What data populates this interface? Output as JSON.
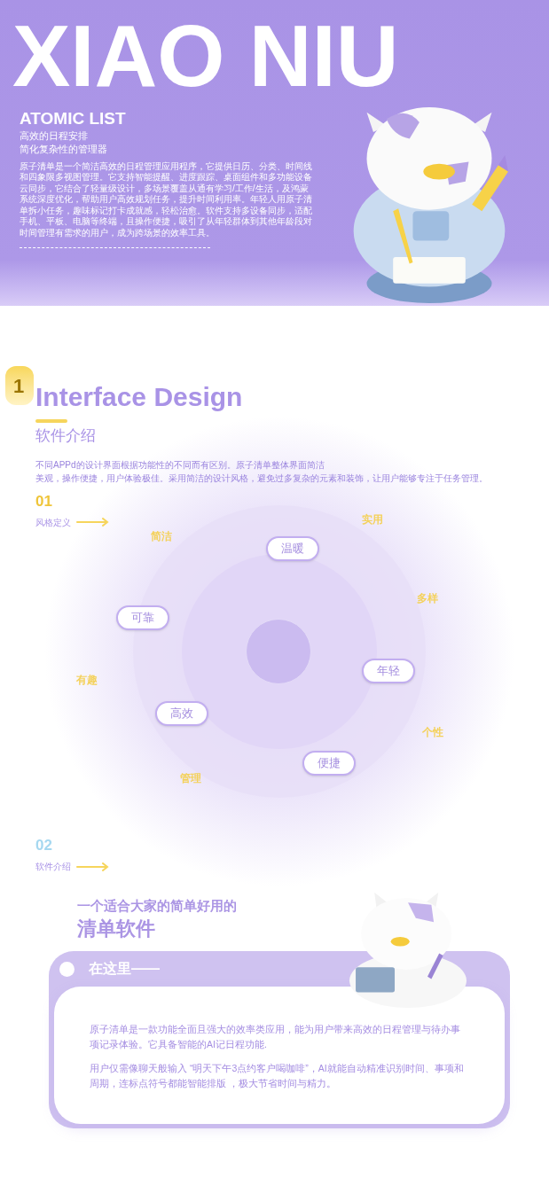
{
  "hero": {
    "title": "XIAO NIU",
    "brand": "ATOMIC LIST",
    "taglines": [
      "高效的日程安排",
      "简化复杂性的管理器"
    ],
    "description": "原子清单是一个简洁高效的日程管理应用程序，它提供日历、分类、时间线和四象限多视图管理。它支持智能提醒、进度跟踪、桌面组件和多功能设备云同步，它结合了轻量级设计，多场景覆盖从通有学习/工作/生活，及鸿蒙系统深度优化，帮助用户高效规划任务，提升时间利用率。年轻人用原子清单拆小任务，趣味标记打卡成就感，轻松治愈。软件支持多设备同步，适配手机、平板、电脑等终端，且操作便捷，吸引了从年轻群体到其他年龄段对时间管理有需求的用户，成为跨场景的效率工具。"
  },
  "intro": {
    "badge": "1",
    "title": "Interface Design",
    "subtitle": "软件介绍",
    "paragraph_lines": [
      "不同APPd的设计界面根据功能性的不同而有区别。原子清单整体界面简洁",
      "美观，操作便捷，用户体验极佳。采用简洁的设计风格，避免过多复杂的元素和装饰，让用户能够专注于任务管理。"
    ]
  },
  "style_section": {
    "number": "01",
    "label": "风格定义",
    "keywords": [
      {
        "kind": "word",
        "text": "实用"
      },
      {
        "kind": "word",
        "text": "简洁"
      },
      {
        "kind": "bubble",
        "text": "温暖"
      },
      {
        "kind": "word",
        "text": "多样"
      },
      {
        "kind": "bubble",
        "text": "可靠"
      },
      {
        "kind": "bubble",
        "text": "年轻"
      },
      {
        "kind": "word",
        "text": "有趣"
      },
      {
        "kind": "bubble",
        "text": "高效"
      },
      {
        "kind": "word",
        "text": "个性"
      },
      {
        "kind": "bubble",
        "text": "便捷"
      },
      {
        "kind": "word",
        "text": "管理"
      }
    ]
  },
  "about_section": {
    "number": "02",
    "label": "软件介绍",
    "headline": "一个适合大家的简单好用的",
    "headline_big": "清单软件",
    "card": {
      "title": "在这里——",
      "paragraphs": [
        "原子清单是一款功能全面且强大的效率类应用，能为用户带来高效的日程管理与待办事项记录体验。它具备智能的AI记日程功能.",
        "用户仅需像聊天般输入 “明天下午3点约客户喝咖啡”，AI就能自动精准识别时间、事项和周期，连标点符号都能智能排版 ，极大节省时间与精力。"
      ]
    }
  }
}
